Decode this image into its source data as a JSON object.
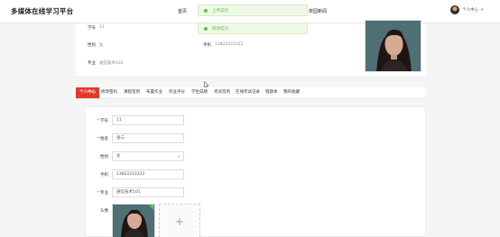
{
  "header": {
    "brand": "多媒体在线学习平台",
    "nav_home": "首页",
    "nav_right": "校园新闻",
    "user_name": "个人中心",
    "user_chevron": "▾"
  },
  "profile_summary": {
    "student_no_label": "学号",
    "student_no_value": "11",
    "gender_label": "性别",
    "gender_value": "女",
    "phone_label": "手机",
    "phone_value": "13822222222",
    "major_label": "专业",
    "major_value": "通信技术101"
  },
  "tabs": [
    {
      "label": "个人中心",
      "active": true
    },
    {
      "label": "修改密码",
      "active": false
    },
    {
      "label": "课程签到",
      "active": false
    },
    {
      "label": "布置作业",
      "active": false
    },
    {
      "label": "作业评分",
      "active": false
    },
    {
      "label": "学生成绩",
      "active": false
    },
    {
      "label": "考试签到",
      "active": false
    },
    {
      "label": "在线考试记录",
      "active": false
    },
    {
      "label": "错题本",
      "active": false
    },
    {
      "label": "我的收藏",
      "active": false
    }
  ],
  "form": {
    "student_no": {
      "label": "学号",
      "value": "11",
      "required": true
    },
    "name": {
      "label": "姓名",
      "value": "张三",
      "required": true
    },
    "gender": {
      "label": "性别",
      "value": "女",
      "required": false
    },
    "phone": {
      "label": "手机",
      "value": "13822222222",
      "required": false
    },
    "major": {
      "label": "专业",
      "value": "通信技术101",
      "required": true
    },
    "avatar_label": "头像",
    "upload_plus": "+",
    "upload_check": "✓",
    "select_arrow": "▾"
  },
  "toasts": [
    {
      "text": "上传成功",
      "color": "#67c23a"
    },
    {
      "text": "修改成功",
      "color": "#67c23a"
    }
  ],
  "colors": {
    "accent": "#e4382a",
    "success": "#67c23a"
  }
}
